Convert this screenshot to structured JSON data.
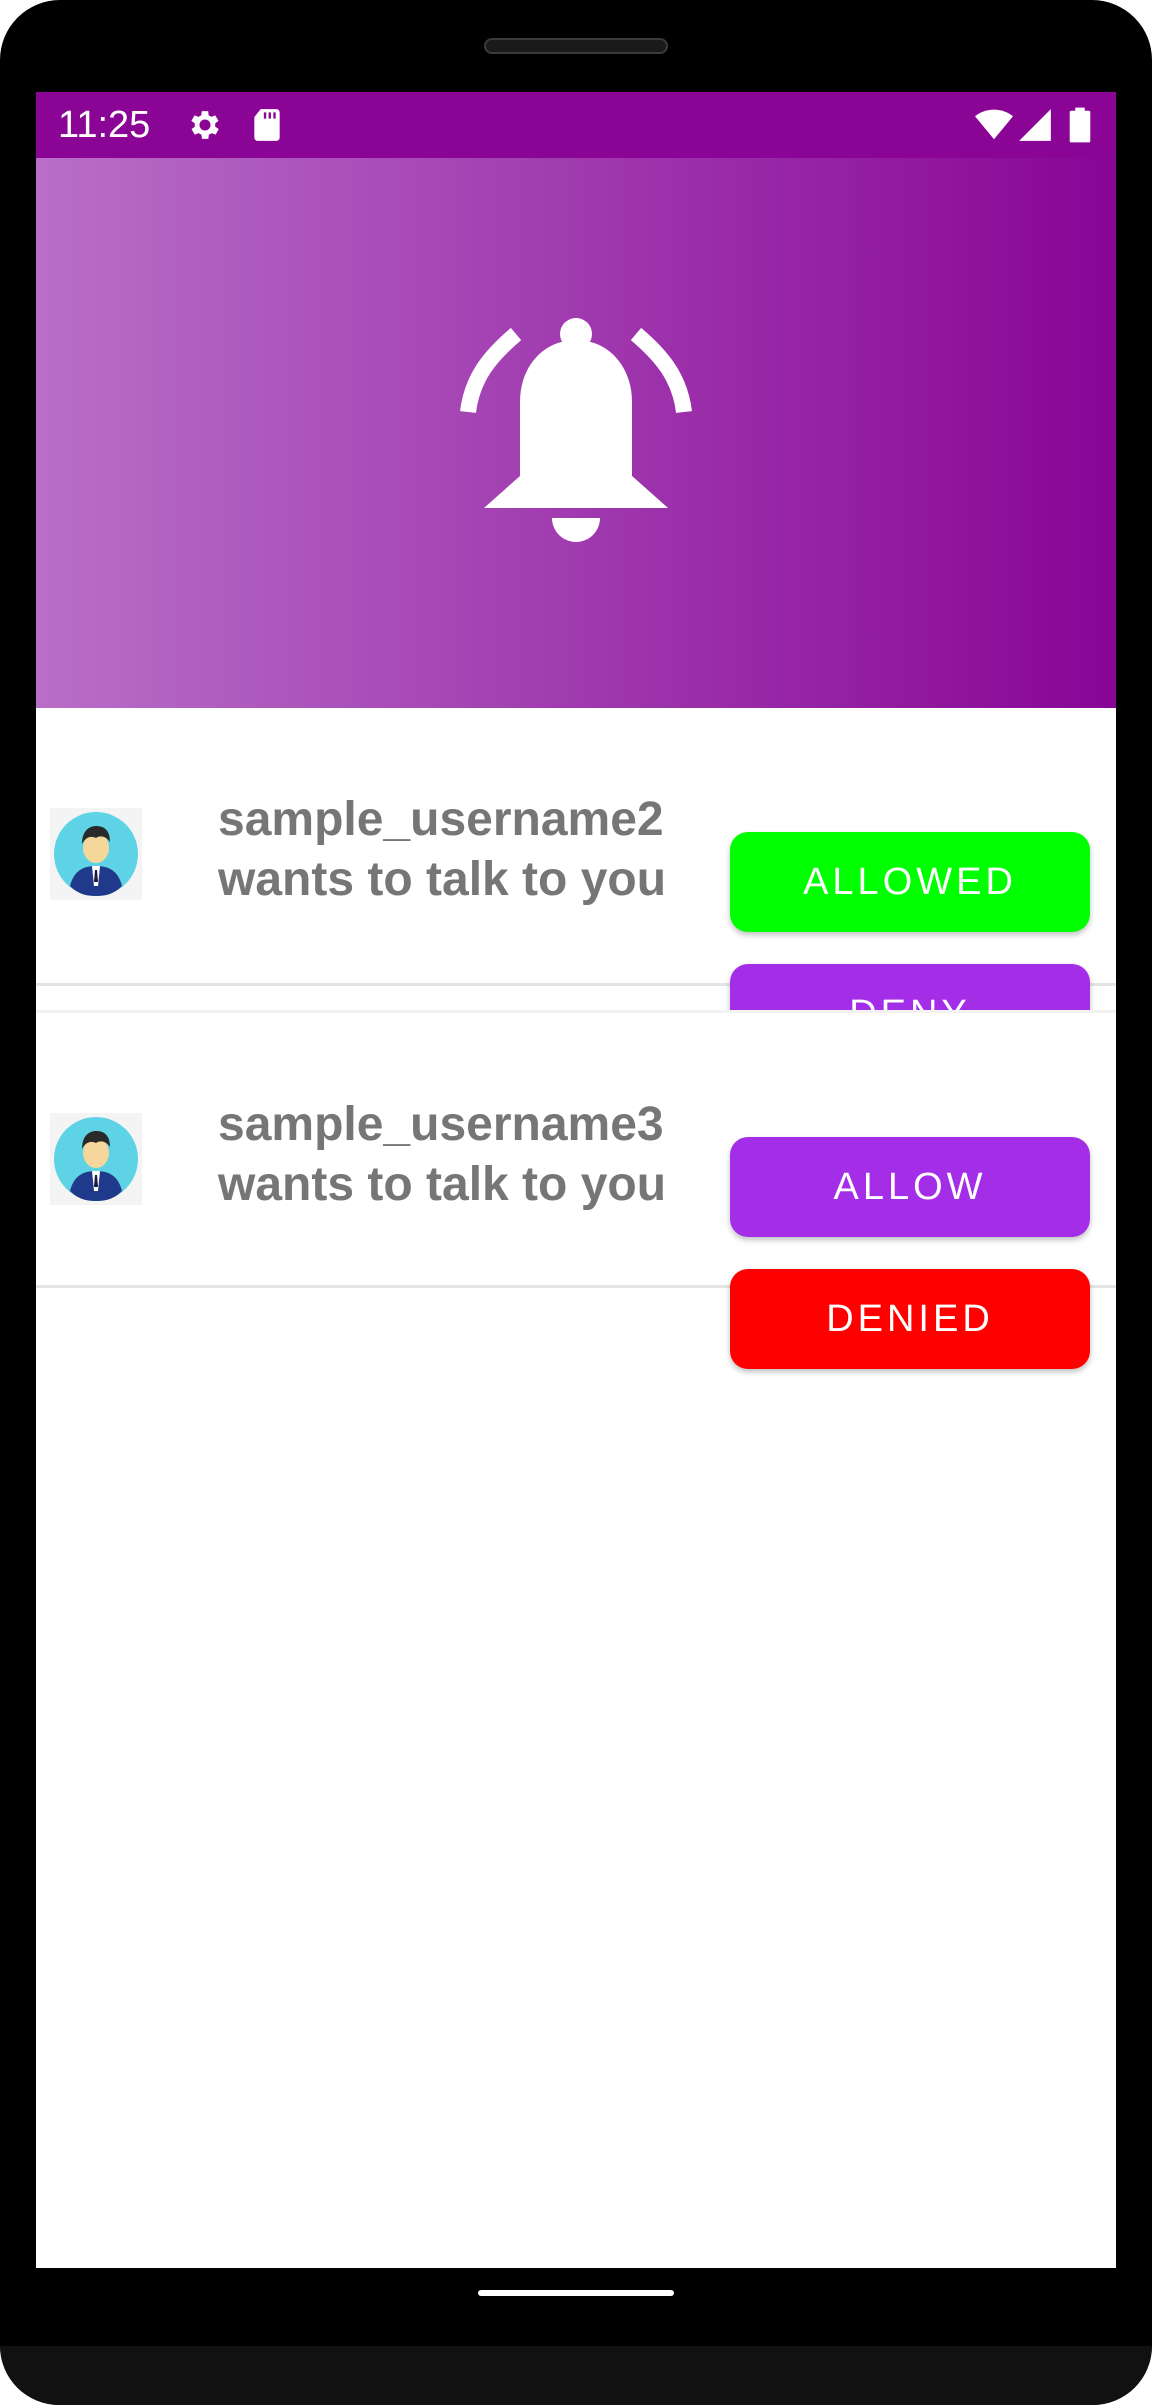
{
  "status_bar": {
    "time": "11:25",
    "background": "#8a0596",
    "icons": [
      "gear-icon",
      "sd-card-icon",
      "wifi-icon",
      "signal-icon",
      "battery-icon"
    ]
  },
  "header": {
    "gradient_start": "#b86fc8",
    "gradient_end": "#880596",
    "icon": "bell-ringing-icon"
  },
  "requests": [
    {
      "avatar_icon": "user-avatar-icon",
      "username": "sample_username2",
      "message": "wants to talk to you",
      "top_button": {
        "label": "ALLOWED",
        "color": "#00ff00"
      },
      "bottom_button": {
        "label": "DENY",
        "color": "#a42de8"
      }
    },
    {
      "avatar_icon": "user-avatar-icon",
      "username": "sample_username3",
      "message": "wants to talk to you",
      "top_button": {
        "label": "ALLOW",
        "color": "#a42de8"
      },
      "bottom_button": {
        "label": "DENIED",
        "color": "#ff0000"
      }
    }
  ]
}
